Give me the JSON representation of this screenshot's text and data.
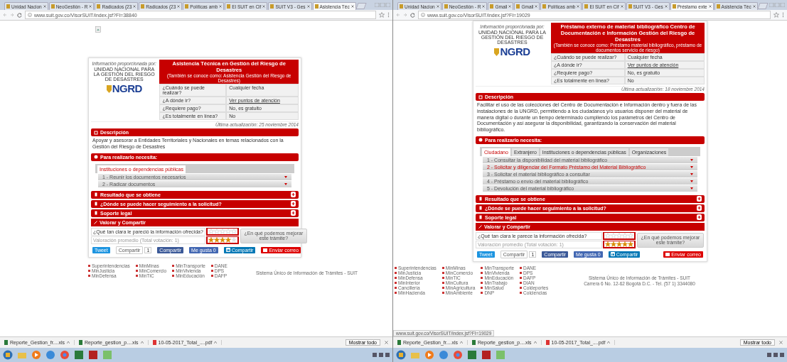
{
  "windows": [
    {
      "kind": "top",
      "tabs": [
        {
          "label": "Unidad Nacion",
          "selected": false
        },
        {
          "label": "NeoGestión - R",
          "selected": false
        },
        {
          "label": "Radicados (23",
          "selected": false
        },
        {
          "label": "Radicados (23",
          "selected": false
        },
        {
          "label": "Políticas amb",
          "selected": false
        },
        {
          "label": "El SUIT en Cif",
          "selected": false
        },
        {
          "label": "SUIT V3 - Ges",
          "selected": false
        },
        {
          "label": "Asistencia Téc",
          "selected": true
        }
      ],
      "address": "www.suit.gov.co/VisorSUIT/index.jsf?FI=38840",
      "card": {
        "provider_label": "Información proporcionada por:",
        "organization": "UNIDAD NACIONAL PARA LA GESTIÓN DEL RIESGO DE DESASTRES",
        "logo_text": "NGRD",
        "title": "Asistencia Técnica en Gestión del Riesgo de Desastres",
        "subtitle": "(También se conoce como: Asistencia Gestión del Riesgo de Desastres)",
        "facts": [
          {
            "question": "¿Cuándo se puede realizar?",
            "answer": "Cualquier fecha",
            "link": false
          },
          {
            "question": "¿A dónde ir?",
            "answer": "Ver puntos de atención",
            "link": true
          },
          {
            "question": "¿Requiere pago?",
            "answer": "No, es gratuito",
            "link": false
          },
          {
            "question": "¿Es totalmente en línea?",
            "answer": "No",
            "link": false
          }
        ],
        "updated": "Última actualización: 25 noviembre 2014",
        "sections": [
          {
            "kind": "text",
            "title": "Descripción",
            "text": "Apoyar y asesorar a Entidades Territoriales y Nacionales en temas relacionados con la Gestión del Riesgo de Desastres"
          },
          {
            "kind": "steps",
            "title": "Para realizarlo necesita:",
            "tabs": [
              {
                "label": "Instituciones o dependencias públicas",
                "selected": true
              }
            ],
            "steps": [
              {
                "label": "1 - Reunir los documentos necesarios",
                "highlighted": false
              },
              {
                "label": "2 - Radicar documentos",
                "highlighted": false
              }
            ]
          },
          {
            "kind": "collapsed",
            "title": "Resultado que se obtiene"
          },
          {
            "kind": "collapsed",
            "title": "¿Dónde se puede hacer seguimiento a la solicitud?"
          },
          {
            "kind": "collapsed",
            "title": "Soporte legal"
          }
        ],
        "rating": {
          "title": "Valorar y Compartir",
          "question": "¿Qué tan clara le pareció la información ofrecida?",
          "average": {
            "label": "Valoración promedio (Total votación: 1)",
            "stars": 4
          },
          "improve_button": "¿En qué podemos mejorar este trámite?"
        },
        "share": [
          {
            "kind": "twitter",
            "label": "Tweet"
          },
          {
            "kind": "gplus",
            "label": "Compartir",
            "count": "1"
          },
          {
            "kind": "facebook",
            "label": "Compartir"
          },
          {
            "kind": "like",
            "label": "Me gusta 0"
          },
          {
            "kind": "linkedin",
            "label": "Compartir"
          },
          {
            "kind": "email",
            "label": "Enviar correo"
          }
        ]
      },
      "footer": {
        "links": [
          [
            "Superintendencias",
            "MinJusticia",
            "MinDefensa"
          ],
          [
            "MinMinas",
            "MinComercio",
            "MinTIC"
          ],
          [
            "MinTransporte",
            "MinVivienda",
            "MinEducación"
          ],
          [
            "DANE",
            "DPS",
            "DAFP"
          ]
        ],
        "text": [
          "Sistema Único de Información de Trámites - SUIT"
        ]
      },
      "downloads": [
        "Reporte_Gestion_fr....xls",
        "Reporte_gestion_p....xls",
        "10-05-2017_Total_....pdf"
      ],
      "show_all": "Mostrar todo"
    },
    {
      "kind": "scrolled",
      "tabs": [
        {
          "label": "Unidad Nacion",
          "selected": false
        },
        {
          "label": "NeoGestión - R",
          "selected": false
        },
        {
          "label": "Gmail",
          "selected": false
        },
        {
          "label": "Gmail",
          "selected": false
        },
        {
          "label": "Políticas amb",
          "selected": false
        },
        {
          "label": "El SUIT en Cif",
          "selected": false
        },
        {
          "label": "SUIT V3 - Ges",
          "selected": false
        },
        {
          "label": "Préstamo exte",
          "selected": true
        },
        {
          "label": "Asistencia Téc",
          "selected": false
        }
      ],
      "address": "www.suit.gov.co/VisorSUIT/index.jsf?FI=19029",
      "card": {
        "provider_label": "Información proporcionada por:",
        "organization": "UNIDAD NACIONAL PARA LA GESTIÓN DEL RIESGO DE DESASTRES",
        "logo_text": "NGRD",
        "title": "Préstamo externo de material bibliográfico Centro de Documentación e Información Gestión del Riesgo de Desastres",
        "subtitle": "(También se conoce como: Préstamo material bibliográfico, préstamo de documentos servicio de riesgo)",
        "facts": [
          {
            "question": "¿Cuándo se puede realizar?",
            "answer": "Cualquier fecha",
            "link": false
          },
          {
            "question": "¿A dónde ir?",
            "answer": "Ver puntos de atención",
            "link": true
          },
          {
            "question": "¿Requiere pago?",
            "answer": "No, es gratuito",
            "link": false
          },
          {
            "question": "¿Es totalmente en línea?",
            "answer": "No",
            "link": false
          }
        ],
        "updated": "Última actualización: 18 noviembre 2014",
        "sections": [
          {
            "kind": "text",
            "title": "Descripción",
            "text": "Facilitar el uso de las colecciones del Centro de Documentación e Información dentro y fuera de las instalaciones de la UNGRD, permitiendo a los ciudadanos y/o usuarios disponer del material de manera digital o durante un tiempo determinado cumpliendo los parámetros del Centro de Documentación y así asegurar la disponibilidad, garantizando la conservación del material bibliográfico."
          },
          {
            "kind": "steps",
            "title": "Para realizarlo necesita:",
            "tabs": [
              {
                "label": "Ciudadano",
                "selected": true
              },
              {
                "label": "Extranjero",
                "selected": false
              },
              {
                "label": "Instituciones o dependencias públicas",
                "selected": false
              },
              {
                "label": "Organizaciones",
                "selected": false
              }
            ],
            "steps": [
              {
                "label": "1 - Consultar la disponibilidad del material bibliográfico",
                "highlighted": false
              },
              {
                "label": "2 - Solicitar y diligenciar del Formato Préstamo del Material Bibliográfico",
                "highlighted": true
              },
              {
                "label": "3 - Solicitar el material bibliográfico a consultar",
                "highlighted": false
              },
              {
                "label": "4 - Préstamo o envío del material bibliográfico",
                "highlighted": false
              },
              {
                "label": "5 - Devolución del material bibliográfico",
                "highlighted": false
              }
            ]
          },
          {
            "kind": "collapsed",
            "title": "Resultado que se obtiene"
          },
          {
            "kind": "collapsed",
            "title": "¿Dónde se puede hacer seguimiento a la solicitud?"
          },
          {
            "kind": "collapsed",
            "title": "Soporte legal"
          }
        ],
        "rating": {
          "title": "Valorar y Compartir",
          "question": "¿Qué tan clara le parece la información ofrecida?",
          "average": {
            "label": "Valoración promedio (Total votación: 1)",
            "stars": 5
          },
          "improve_button": "¿En qué podemos mejorar este trámite?"
        },
        "share": [
          {
            "kind": "twitter",
            "label": "Tweet"
          },
          {
            "kind": "gplus",
            "label": "Compartir",
            "count": "1"
          },
          {
            "kind": "facebook",
            "label": "Compartir"
          },
          {
            "kind": "like",
            "label": "Me gusta 0"
          },
          {
            "kind": "linkedin",
            "label": "Compartir"
          },
          {
            "kind": "email",
            "label": "Enviar correo"
          }
        ]
      },
      "footer": {
        "links": [
          [
            "Superintendencias",
            "MinJusticia",
            "MinDefensa",
            "MinInterior",
            "Cancillería",
            "MinHacienda"
          ],
          [
            "MinMinas",
            "MinComercio",
            "MinTIC",
            "MinCultura",
            "MinAgricultura",
            "MinAmbiente"
          ],
          [
            "MinTransporte",
            "MinVivienda",
            "MinEducación",
            "MinTrabajo",
            "MinSalud",
            "DNP"
          ],
          [
            "DANE",
            "DPS",
            "DAFP",
            "DIAN",
            "Coldeportes",
            "Colciencias"
          ]
        ],
        "text": [
          "Sistema Único de Información de Trámites - SUIT",
          "Carrera 6 No. 12-62 Bogotá D.C. - Tel. (57 1) 3344080"
        ]
      },
      "status_url": "www.suit.gov.co/VisorSUIT/index.jsf?FI=19029",
      "downloads": [
        "Reporte_Gestion_fr....xls",
        "Reporte_gestion_p....xls",
        "10-05-2017_Total_....pdf"
      ],
      "show_all": "Mostrar todo"
    }
  ]
}
